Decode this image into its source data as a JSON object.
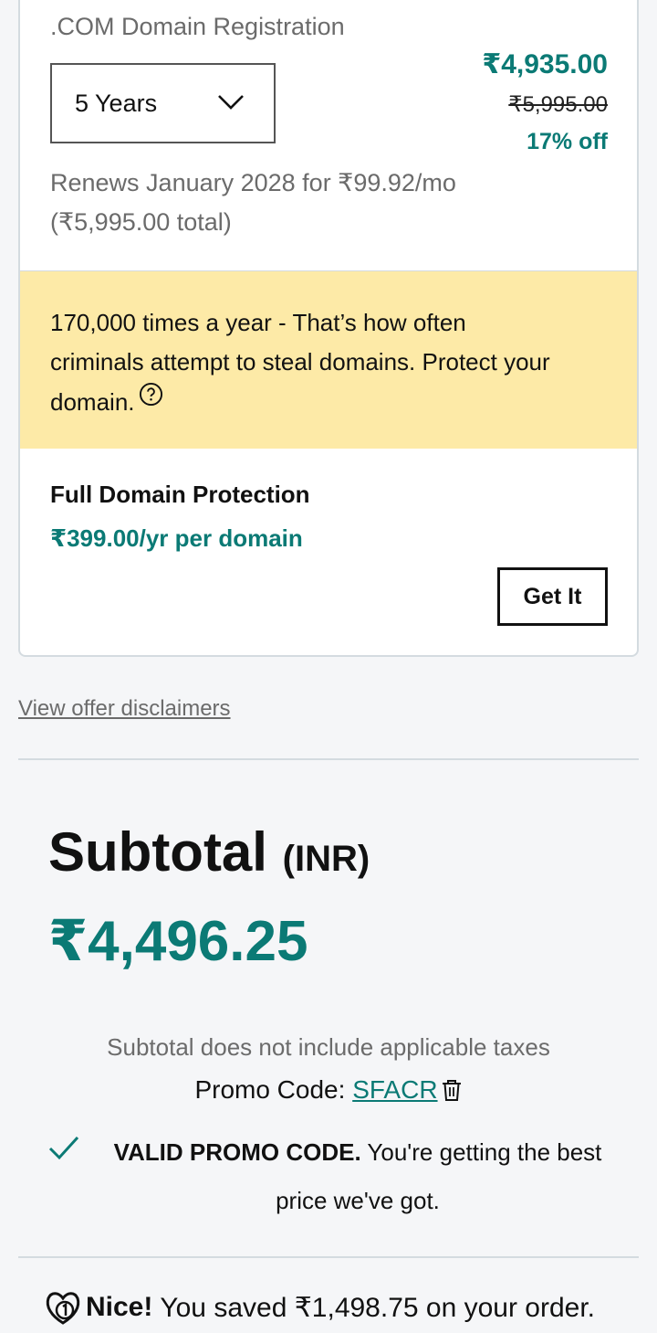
{
  "product": {
    "name": ".COM Domain Registration",
    "term": "5 Years",
    "price_now": "₹4,935.00",
    "price_old": "₹5,995.00",
    "discount": "17% off",
    "renews_line1": "Renews January 2028 for ₹99.92/mo",
    "renews_line2": "(₹5,995.00 total)"
  },
  "alert": {
    "text": "170,000 times a year - That’s how often criminals attempt to steal domains. Protect your domain."
  },
  "protection": {
    "title": "Full Domain Protection",
    "price": "₹399.00/yr per domain",
    "button": "Get It"
  },
  "disclaimers_link": "View offer disclaimers",
  "summary": {
    "subtotal_label": "Subtotal",
    "currency": "(INR)",
    "amount": "₹4,496.25",
    "tax_note": "Subtotal does not include applicable taxes",
    "promo_label": "Promo Code: ",
    "promo_code": "SFACR",
    "valid_bold": "VALID PROMO CODE.",
    "valid_rest": " You're getting the best price we've got.",
    "saved_bold": "Nice!",
    "saved_text": "You saved ₹1,498.75 on your order."
  },
  "colors": {
    "accent": "#0b7a75",
    "alert_bg": "#fdeaa7",
    "muted_text": "#6b6b6b"
  },
  "icons": [
    "chevron-down-icon",
    "help-icon",
    "trash-icon",
    "check-icon",
    "godaddy-logo-icon"
  ]
}
